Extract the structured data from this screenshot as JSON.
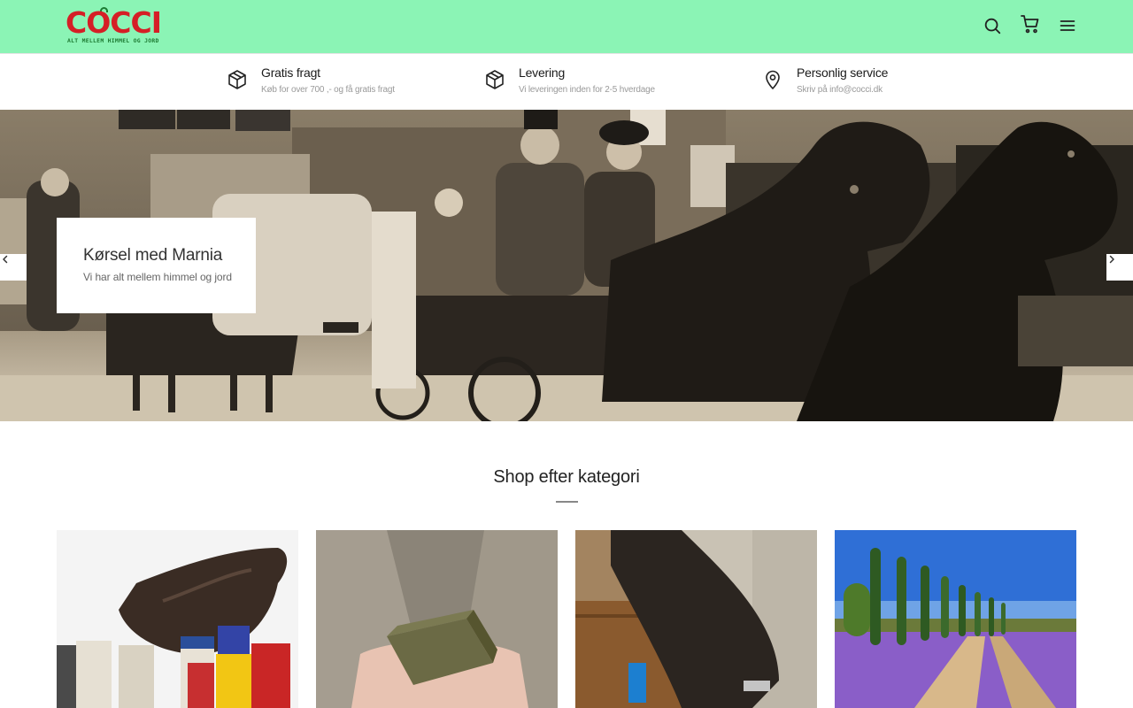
{
  "brand": {
    "name": "COCCI",
    "tagline": "ALT MELLEM HIMMEL OG JORD",
    "colors": {
      "header_bg": "#8bf4b5",
      "logo_red": "#d51f26",
      "logo_green": "#1d7a32"
    }
  },
  "header": {
    "icons": [
      "search-icon",
      "cart-icon",
      "menu-icon"
    ]
  },
  "features": [
    {
      "icon": "package-icon",
      "title": "Gratis fragt",
      "subtitle": "Køb for over 700 ,- og få gratis fragt"
    },
    {
      "icon": "package-icon",
      "title": "Levering",
      "subtitle": "Vi leveringen inden for 2-5 hverdage"
    },
    {
      "icon": "map-pin-icon",
      "title": "Personlig service",
      "subtitle": "Skriv på info@cocci.dk"
    }
  ],
  "hero": {
    "title": "Kørsel med Marnia",
    "subtitle": "Vi har alt mellem himmel og jord",
    "prev_icon": "chevron-left-icon",
    "next_icon": "chevron-right-icon"
  },
  "categories_section": {
    "title": "Shop efter kategori",
    "images": [
      "saddle-and-care-products",
      "olive-soap-in-hands",
      "saddle-on-fence",
      "lavender-field-cypress"
    ]
  }
}
